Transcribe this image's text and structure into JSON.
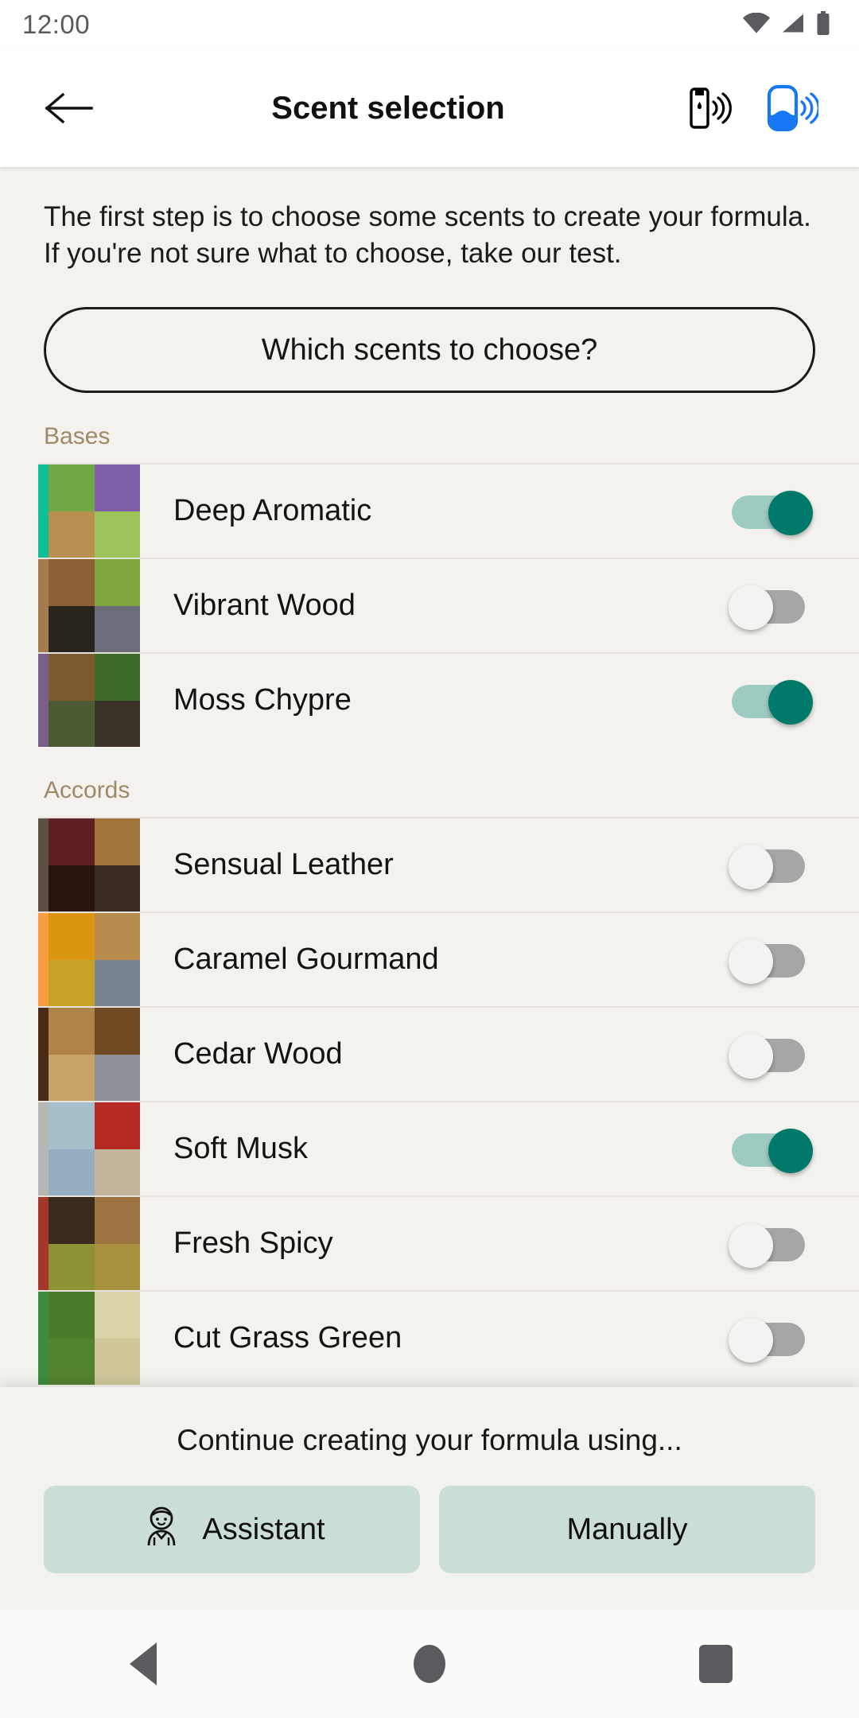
{
  "status_bar": {
    "time": "12:00",
    "icons": [
      "wifi-icon",
      "cellular-signal-icon",
      "battery-icon"
    ]
  },
  "app_bar": {
    "back_icon": "arrow-left-icon",
    "title": "Scent selection",
    "actions": [
      {
        "icon": "cartridge-connection-icon",
        "color": "#000000"
      },
      {
        "icon": "device-connection-icon",
        "color": "#1877F2"
      }
    ]
  },
  "main": {
    "intro_text": "The first step is to choose some scents to create your formula. If you're not sure what to choose, take our test.",
    "which_button_label": "Which scents to choose?",
    "sections": [
      {
        "label": "Bases",
        "items": [
          {
            "name": "Deep Aromatic",
            "accent": "#0FBF96",
            "enabled": true,
            "thumb": [
              "#6FA844",
              "#7E5FA8",
              "#B89150",
              "#9CC45A"
            ]
          },
          {
            "name": "Vibrant Wood",
            "accent": "#A67B4F",
            "enabled": false,
            "thumb": [
              "#8C6135",
              "#7EA83E",
              "#2A241E",
              "#6B6E79"
            ]
          },
          {
            "name": "Moss Chypre",
            "accent": "#7A5E8C",
            "enabled": true,
            "thumb": [
              "#7C5C2E",
              "#3E6B2A",
              "#4C5B33",
              "#3A3328"
            ]
          }
        ]
      },
      {
        "label": "Accords",
        "items": [
          {
            "name": "Sensual Leather",
            "accent": "#5E4F45",
            "enabled": false,
            "thumb": [
              "#5E1F23",
              "#A3733C",
              "#2B1410",
              "#3A2C22"
            ]
          },
          {
            "name": "Caramel Gourmand",
            "accent": "#F79C3F",
            "enabled": false,
            "thumb": [
              "#D99510",
              "#B98C4E",
              "#C9A22A",
              "#7B8495"
            ]
          },
          {
            "name": "Cedar Wood",
            "accent": "#4A2A16",
            "enabled": false,
            "thumb": [
              "#B08347",
              "#6F4A22",
              "#C8A36A",
              "#8C9298"
            ]
          },
          {
            "name": "Soft Musk",
            "accent": "#B4B8B5",
            "enabled": true,
            "thumb": [
              "#A7BECB",
              "#B52A24",
              "#96AEC0",
              "#C4B49B"
            ]
          },
          {
            "name": "Fresh Spicy",
            "accent": "#A5372A",
            "enabled": false,
            "thumb": [
              "#3A2C1D",
              "#9B7240",
              "#8D9235",
              "#A8923F"
            ]
          },
          {
            "name": "Cut Grass Green",
            "accent": "#3E8B3E",
            "enabled": false,
            "thumb": [
              "#4B7A2A",
              "#D9D3A8",
              "#54832F",
              "#CFC79A"
            ]
          }
        ]
      }
    ]
  },
  "bottom_sheet": {
    "title": "Continue creating your formula using...",
    "buttons": [
      {
        "label": "Assistant",
        "icon": "assistant-avatar-icon"
      },
      {
        "label": "Manually",
        "icon": null
      }
    ]
  },
  "nav_bar": {
    "back": "triangle-back-icon",
    "home": "circle-home-icon",
    "recents": "square-recents-icon"
  },
  "colors": {
    "accent_teal": "#00796B",
    "track_on": "#9CCBC2",
    "track_off": "#A6A6A6",
    "section_label": "#A08968",
    "page_background": "#F4F2EE",
    "sheet_button": "#CBDED6"
  }
}
